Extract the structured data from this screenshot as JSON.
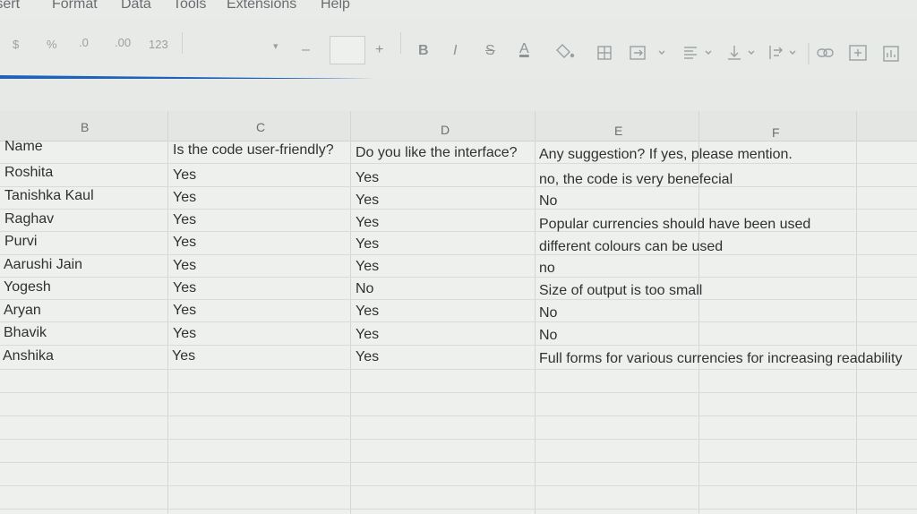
{
  "menu": [
    "Insert",
    "Format",
    "Data",
    "Tools",
    "Extensions",
    "Help"
  ],
  "toolbar": {
    "currency": "$",
    "percent": "%",
    "decrease_decimals": ".0",
    "increase_decimals": ".00",
    "number_format": "123",
    "font_dropdown": "▾",
    "font_minus": "–",
    "font_plus": "+",
    "bold": "B",
    "italic": "I",
    "strikethrough": "S",
    "text_color": "A"
  },
  "columns": [
    "B",
    "C",
    "D",
    "E",
    "F"
  ],
  "table": {
    "headers": [
      "Name",
      "Is the code user-friendly?",
      "Do you like the interface?",
      "Any suggestion? If yes, please mention."
    ],
    "rows": [
      [
        "Roshita",
        "Yes",
        "Yes",
        "no, the code is very benefecial"
      ],
      [
        "Tanishka Kaul",
        "Yes",
        "Yes",
        "No"
      ],
      [
        "Raghav",
        "Yes",
        "Yes",
        "Popular currencies should have been used"
      ],
      [
        "Purvi",
        "Yes",
        "Yes",
        "different colours can be used"
      ],
      [
        "Aarushi Jain",
        "Yes",
        "Yes",
        "no"
      ],
      [
        "Yogesh",
        "Yes",
        "No",
        "Size of output is too small"
      ],
      [
        "Aryan",
        "Yes",
        "Yes",
        "No"
      ],
      [
        "Bhavik",
        "Yes",
        "Yes",
        "No"
      ],
      [
        "Anshika",
        "Yes",
        "Yes",
        "Full forms for various currencies for increasing readability"
      ]
    ]
  },
  "colors": {
    "accent_line": "#1f63b8",
    "grid": "#d3d6d5",
    "header_bg": "#e4e6e4"
  }
}
